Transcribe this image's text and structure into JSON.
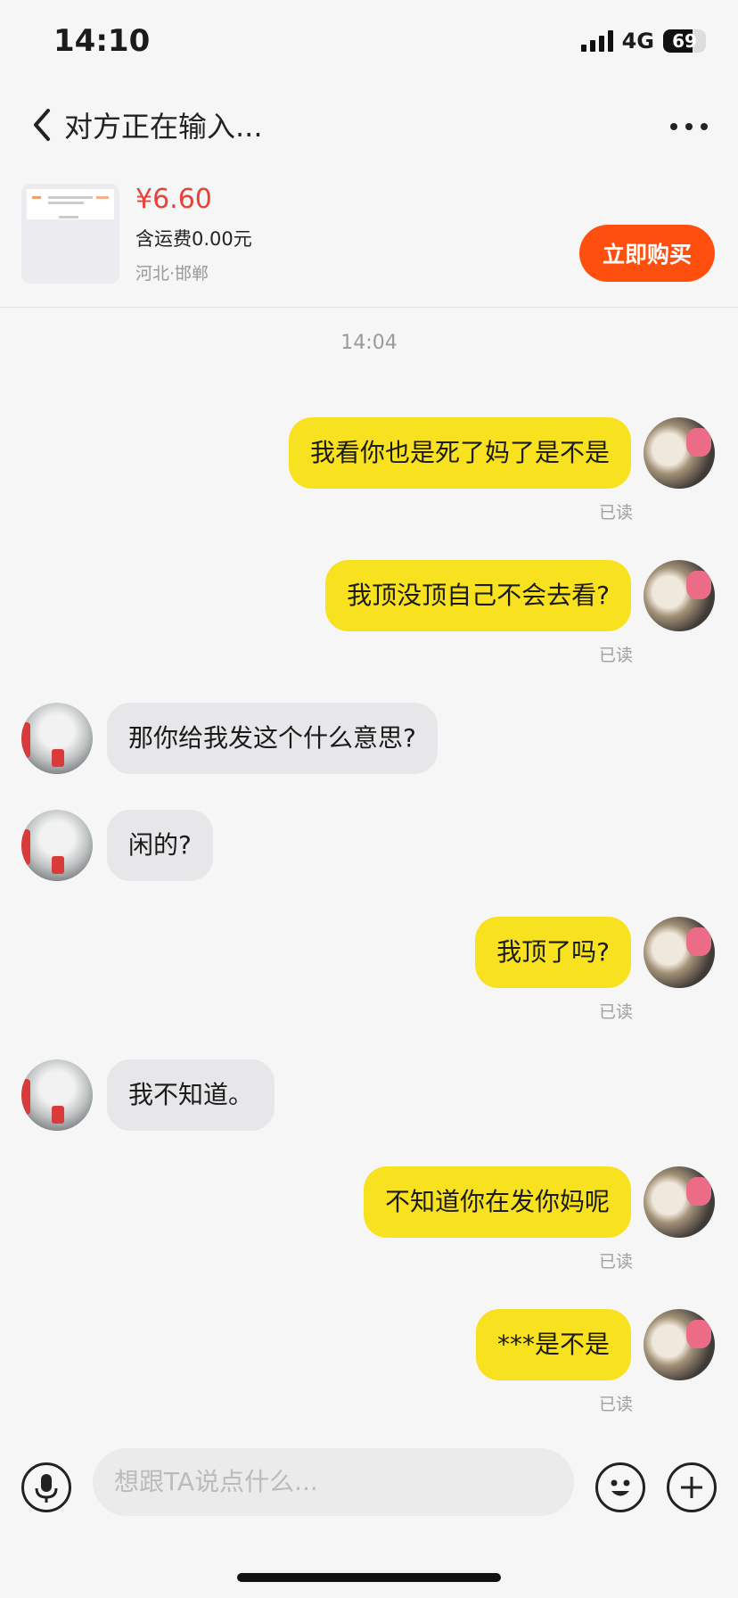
{
  "status_bar": {
    "time": "14:10",
    "network": "4G",
    "battery": "69"
  },
  "header": {
    "title": "对方正在输入..."
  },
  "product": {
    "price": "¥6.60",
    "shipping": "含运费0.00元",
    "location": "河北·邯郸",
    "buy_label": "立即购买"
  },
  "chat": {
    "timestamp": "14:04",
    "messages": [
      {
        "side": "mine",
        "text": "我看你也是死了妈了是不是",
        "status": "已读"
      },
      {
        "side": "mine",
        "text": "我顶没顶自己不会去看?",
        "status": "已读"
      },
      {
        "side": "theirs",
        "text": "那你给我发这个什么意思?"
      },
      {
        "side": "theirs",
        "text": "闲的?"
      },
      {
        "side": "mine",
        "text": "我顶了吗?",
        "status": "已读"
      },
      {
        "side": "theirs",
        "text": "我不知道。"
      },
      {
        "side": "mine",
        "text": "不知道你在发你妈呢",
        "status": "已读"
      },
      {
        "side": "mine",
        "text": "***是不是",
        "status": "已读"
      }
    ]
  },
  "input": {
    "placeholder": "想跟TA说点什么..."
  },
  "colors": {
    "accent": "#ff4f0f",
    "my_bubble": "#f8e11f",
    "their_bubble": "#e7e7ea",
    "price": "#e8413a"
  }
}
